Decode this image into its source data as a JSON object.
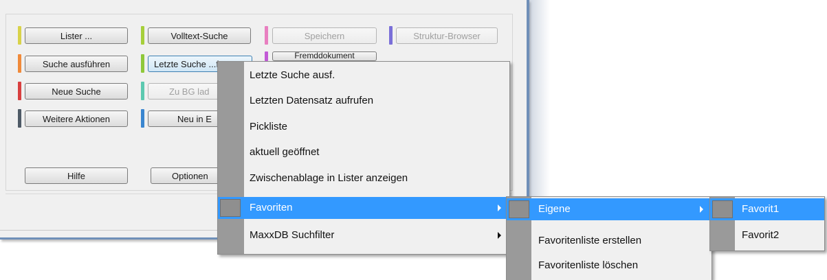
{
  "buttons": {
    "lister": "Lister ...",
    "volltext": "Volltext-Suche",
    "speichern": "Speichern",
    "struktur": "Struktur-Browser",
    "suche_ausfuehren": "Suche ausführen",
    "letzte_suche": "Letzte Suche ...f.",
    "fremddokument": "Fremddokument",
    "neue_suche": "Neue Suche",
    "zu_bg": "Zu BG lad",
    "weitere": "Weitere Aktionen",
    "neu_in": "Neu in E",
    "hilfe": "Hilfe",
    "optionen": "Optionen"
  },
  "stripe_colors": {
    "lister": "#d8d24a",
    "volltext": "#a6cf3a",
    "speichern": "#e87fc0",
    "struktur": "#7a6fd8",
    "suche_ausfuehren": "#f08a3a",
    "letzte_suche": "#8fc83a",
    "fremddokument": "#c25ad6",
    "neue_suche": "#d84040",
    "zu_bg": "#5cc9b0",
    "weitere": "#4e5a66",
    "neu_in": "#3a86d0"
  },
  "context_menu": {
    "items": [
      {
        "label": "Letzte Suche ausf."
      },
      {
        "label": "Letzten Datensatz aufrufen"
      },
      {
        "label": "Pickliste"
      },
      {
        "label": "aktuell geöffnet"
      },
      {
        "label": "Zwischenablage in Lister anzeigen"
      },
      {
        "label": "Favoriten",
        "submenu": true,
        "highlighted": true
      },
      {
        "label": "MaxxDB Suchfilter",
        "submenu": true
      }
    ]
  },
  "favoriten_menu": {
    "items": [
      {
        "label": "Eigene",
        "submenu": true,
        "highlighted": true
      },
      {
        "label": "Favoritenliste erstellen"
      },
      {
        "label": "Favoritenliste löschen"
      }
    ]
  },
  "eigene_menu": {
    "items": [
      {
        "label": "Favorit1",
        "highlighted": true
      },
      {
        "label": "Favorit2"
      }
    ]
  },
  "colors": {
    "highlight": "#3399ff",
    "window_border": "#6f8fb8",
    "gutter": "#9a9a9a"
  }
}
